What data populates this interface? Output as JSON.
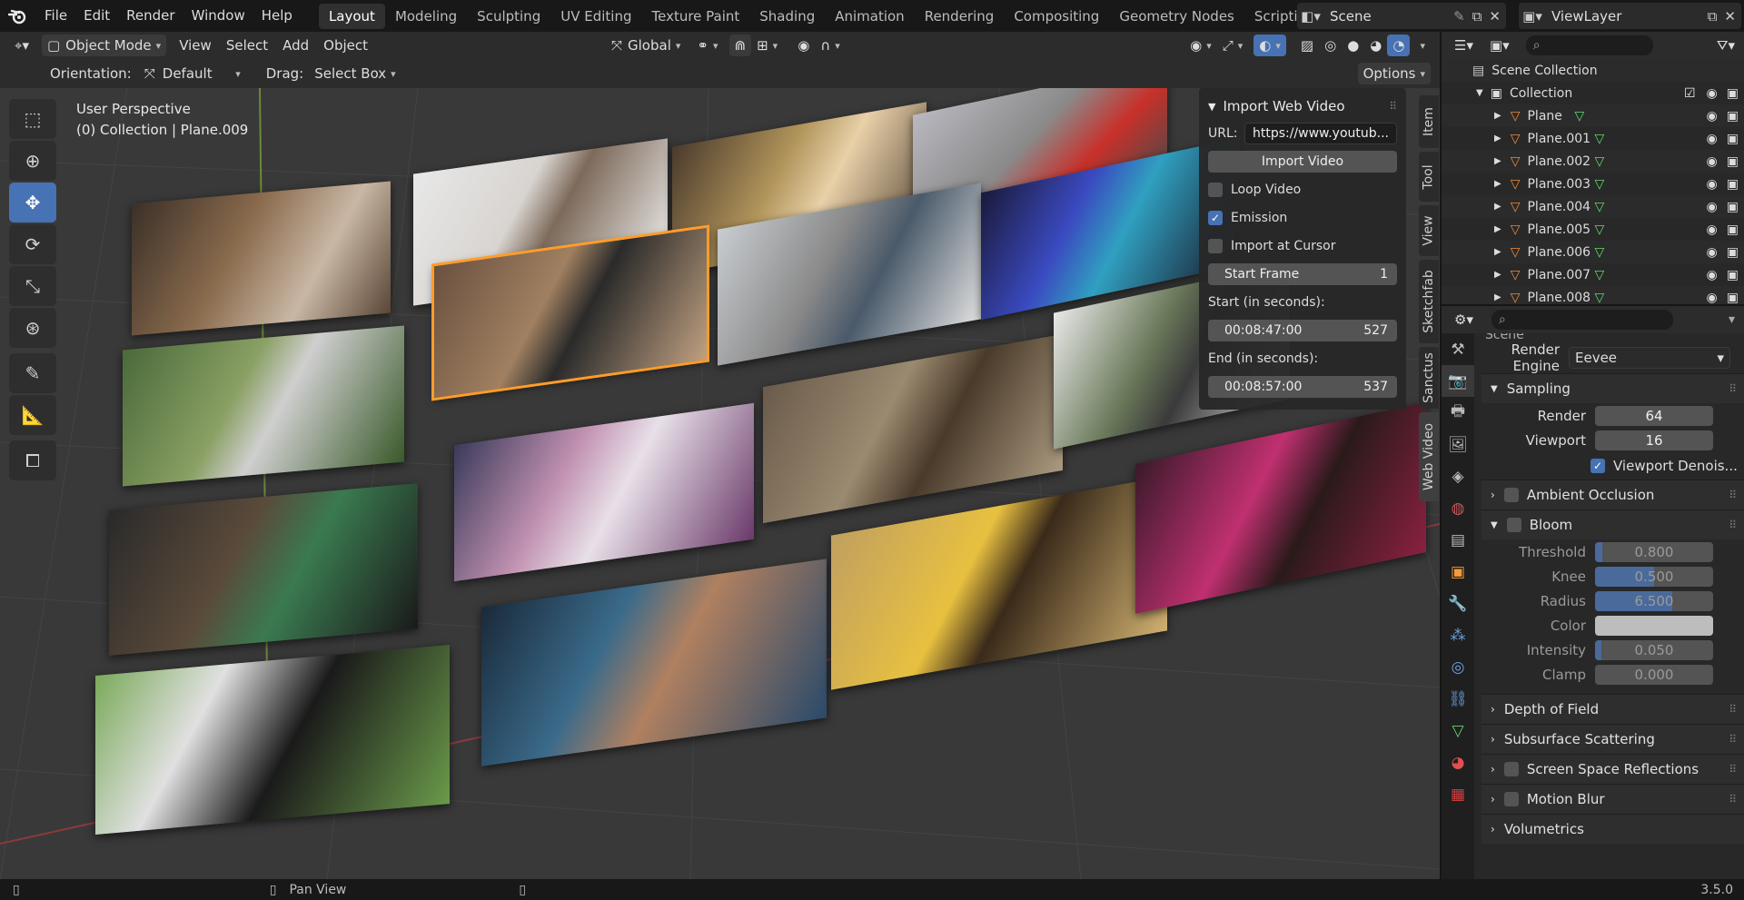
{
  "menu": [
    "File",
    "Edit",
    "Render",
    "Window",
    "Help"
  ],
  "workspaces": [
    "Layout",
    "Modeling",
    "Sculpting",
    "UV Editing",
    "Texture Paint",
    "Shading",
    "Animation",
    "Rendering",
    "Compositing",
    "Geometry Nodes",
    "Scripting"
  ],
  "active_workspace": "Layout",
  "scene_name": "Scene",
  "view_layer": "ViewLayer",
  "header": {
    "mode": "Object Mode",
    "menus": [
      "View",
      "Select",
      "Add",
      "Object"
    ],
    "transform": "Global"
  },
  "header2": {
    "orientation_label": "Orientation:",
    "orientation_value": "Default",
    "drag_label": "Drag:",
    "drag_value": "Select Box",
    "options": "Options"
  },
  "viewport": {
    "title": "User Perspective",
    "subtitle": "(0) Collection | Plane.009"
  },
  "webvideo": {
    "title": "Import Web Video",
    "url_label": "URL:",
    "url_value": "https://www.youtub...",
    "import_btn": "Import Video",
    "loop": "Loop Video",
    "emission": "Emission",
    "at_cursor": "Import at Cursor",
    "start_frame_label": "Start Frame",
    "start_frame_value": "1",
    "start_sec_label": "Start (in seconds):",
    "start_time": "00:08:47:00",
    "start_num": "527",
    "end_sec_label": "End (in seconds):",
    "end_time": "00:08:57:00",
    "end_num": "537"
  },
  "side_tabs": [
    "Item",
    "Tool",
    "View",
    "Sketchfab",
    "Sanctus",
    "Web Video"
  ],
  "outliner": {
    "scene_collection": "Scene Collection",
    "collection": "Collection",
    "items": [
      "Plane",
      "Plane.001",
      "Plane.002",
      "Plane.003",
      "Plane.004",
      "Plane.005",
      "Plane.006",
      "Plane.007",
      "Plane.008"
    ]
  },
  "properties": {
    "scene_label": "Scene",
    "render_engine_label": "Render Engine",
    "render_engine": "Eevee",
    "sampling": "Sampling",
    "render_label": "Render",
    "render_value": "64",
    "viewport_label": "Viewport",
    "viewport_value": "16",
    "viewport_denoise": "Viewport Denois...",
    "ambient_occlusion": "Ambient Occlusion",
    "bloom": "Bloom",
    "threshold_label": "Threshold",
    "threshold": "0.800",
    "knee_label": "Knee",
    "knee": "0.500",
    "radius_label": "Radius",
    "radius": "6.500",
    "color_label": "Color",
    "intensity_label": "Intensity",
    "intensity": "0.050",
    "clamp_label": "Clamp",
    "clamp": "0.000",
    "dof": "Depth of Field",
    "sss": "Subsurface Scattering",
    "ssr": "Screen Space Reflections",
    "motion_blur": "Motion Blur",
    "volumetrics": "Volumetrics"
  },
  "status": {
    "pan_view": "Pan View",
    "version": "3.5.0"
  },
  "colors": {
    "accent": "#4772b3",
    "selection": "#ff9d2a",
    "mesh_icon": "#ec8a3a",
    "data_icon": "#63d86f"
  }
}
